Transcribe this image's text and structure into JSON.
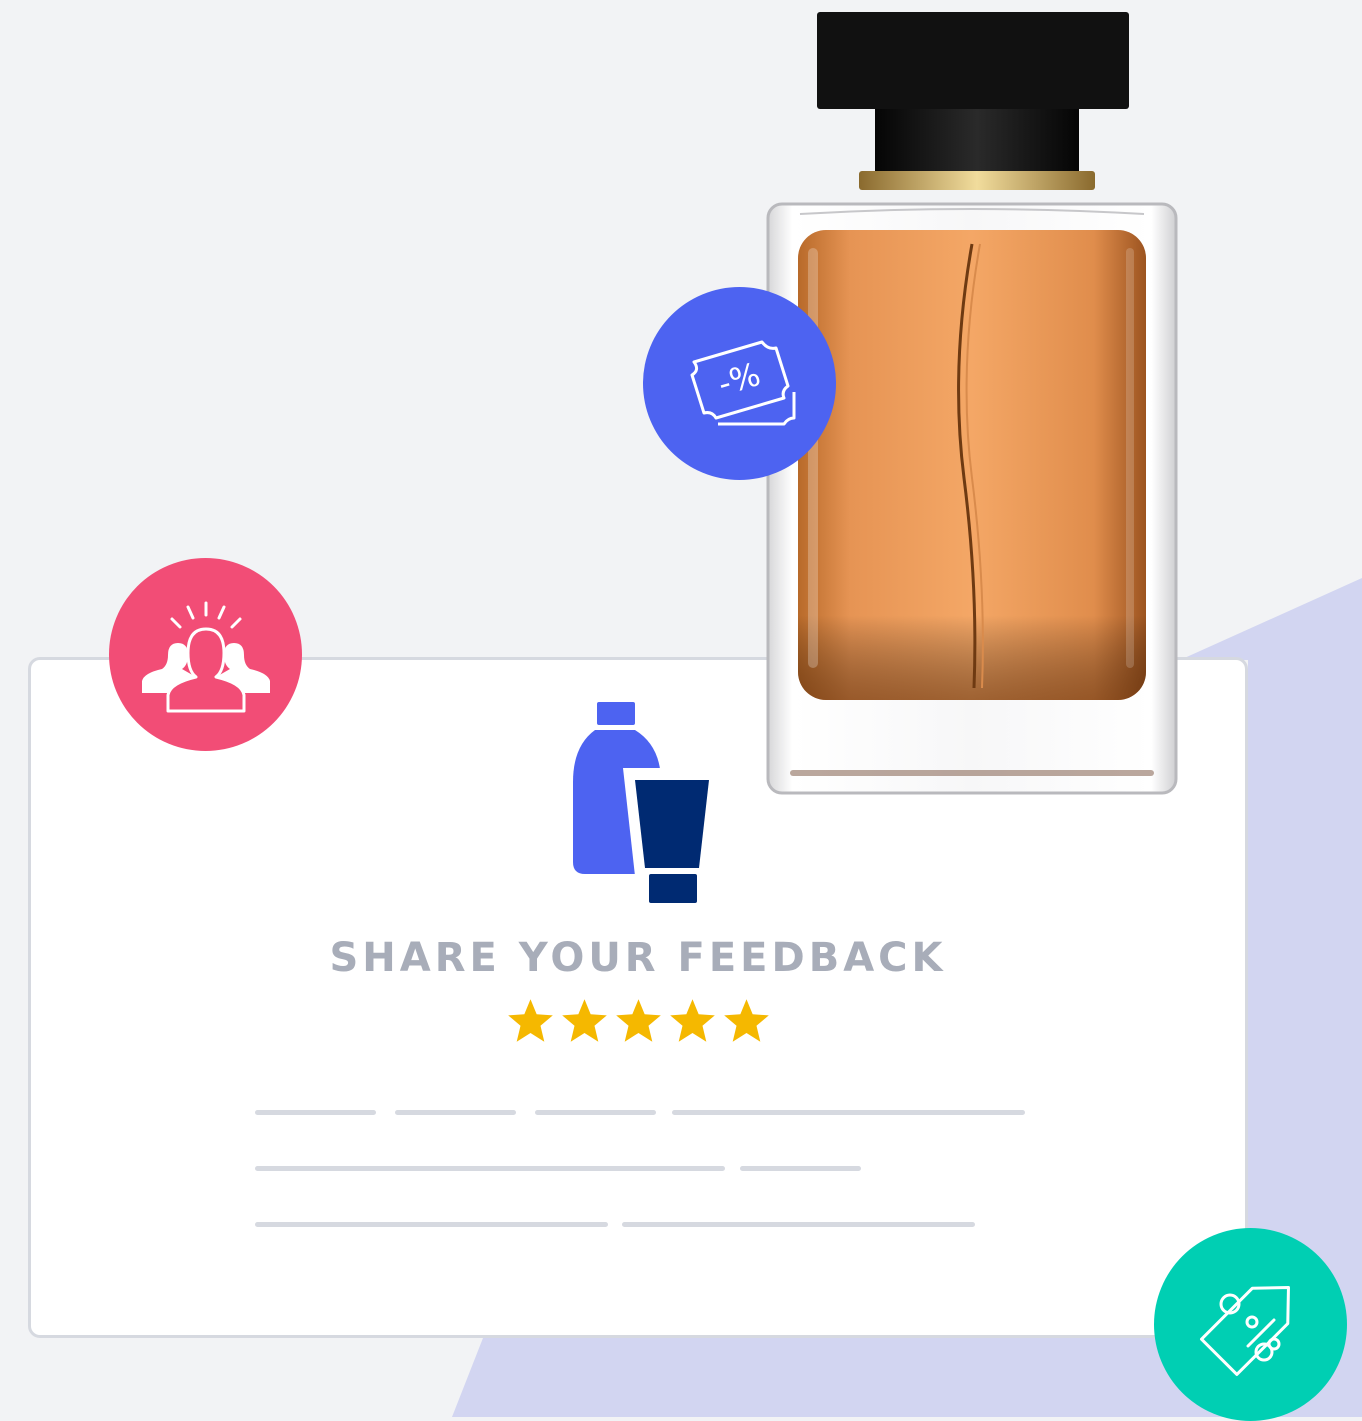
{
  "card": {
    "title": "SHARE YOUR FEEDBACK",
    "rating": 5,
    "rating_max": 5
  },
  "icons": {
    "product": "bottle-and-tube-icon",
    "discount": "discount-coupon-icon",
    "community": "user-group-icon",
    "tag": "percent-tag-icon"
  },
  "colors": {
    "background": "#f2f3f5",
    "accent_shape": "#d2d5f1",
    "discount_badge": "#4d63f1",
    "community_badge": "#f24d76",
    "tag_badge": "#00cfb3",
    "star": "#f5b800",
    "title_text": "#a8adb9",
    "bottle_icon_light": "#4d63f1",
    "tube_icon_dark": "#002a72"
  }
}
